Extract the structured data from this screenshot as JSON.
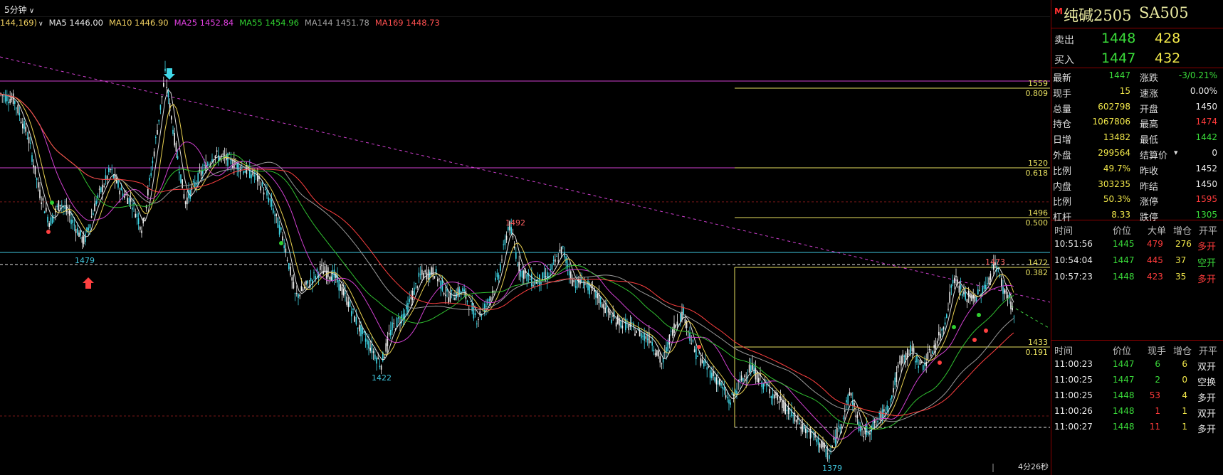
{
  "toolbar": {
    "period": "5分钟"
  },
  "ma_legend": [
    {
      "label": "144,169)",
      "color": "#f0d060"
    },
    {
      "label": "MA5 1446.00",
      "color": "#e8e8e8"
    },
    {
      "label": "MA10 1446.90",
      "color": "#f0d060"
    },
    {
      "label": "MA25 1452.84",
      "color": "#e040e0"
    },
    {
      "label": "MA55 1454.96",
      "color": "#30d030"
    },
    {
      "label": "MA144 1451.78",
      "color": "#a0a0a0"
    },
    {
      "label": "MA169 1448.73",
      "color": "#ff5050"
    }
  ],
  "levels": [
    {
      "price": "1559",
      "ratio": "0.809"
    },
    {
      "price": "1520",
      "ratio": "0.618"
    },
    {
      "price": "1496",
      "ratio": "0.500"
    },
    {
      "price": "1472",
      "ratio": "0.382"
    },
    {
      "price": "1433",
      "ratio": "0.191"
    }
  ],
  "annotations": {
    "low_1479": "1479",
    "high_1492": "1492",
    "low_1422": "1422",
    "high_1473": "1473",
    "low_1379": "1379",
    "countdown": "4分26秒"
  },
  "panel": {
    "indicator": "M",
    "name": "纯碱2505",
    "code": "SA505",
    "orderbook": [
      {
        "label": "卖出",
        "price": "1448",
        "volume": "428"
      },
      {
        "label": "买入",
        "price": "1447",
        "volume": "432"
      }
    ],
    "quote": [
      {
        "l1": "最新",
        "v1": "1447",
        "c1": "green",
        "l2": "涨跌",
        "v2": "-3/0.21%",
        "c2": "green"
      },
      {
        "l1": "现手",
        "v1": "15",
        "c1": "yellow",
        "l2": "速涨",
        "v2": "0.00%",
        "c2": "white"
      },
      {
        "l1": "总量",
        "v1": "602798",
        "c1": "yellow",
        "l2": "开盘",
        "v2": "1450",
        "c2": "white"
      },
      {
        "l1": "持仓",
        "v1": "1067806",
        "c1": "yellow",
        "l2": "最高",
        "v2": "1474",
        "c2": "red"
      },
      {
        "l1": "日增",
        "v1": "13482",
        "c1": "yellow",
        "l2": "最低",
        "v2": "1442",
        "c2": "green"
      },
      {
        "l1": "外盘",
        "v1": "299564",
        "c1": "yellow",
        "l2": "结算价",
        "v2": "0",
        "c2": "white"
      },
      {
        "l1": "比例",
        "v1": "49.7%",
        "c1": "yellow",
        "l2": "昨收",
        "v2": "1452",
        "c2": "white"
      },
      {
        "l1": "内盘",
        "v1": "303235",
        "c1": "yellow",
        "l2": "昨结",
        "v2": "1450",
        "c2": "white"
      },
      {
        "l1": "比例",
        "v1": "50.3%",
        "c1": "yellow",
        "l2": "涨停",
        "v2": "1595",
        "c2": "red"
      },
      {
        "l1": "杠杆",
        "v1": "8.33",
        "c1": "yellow",
        "l2": "跌停",
        "v2": "1305",
        "c2": "green"
      }
    ],
    "big_trades_header": {
      "time": "时间",
      "price": "价位",
      "big": "大单",
      "inc": "增仓",
      "type": "开平"
    },
    "big_trades": [
      {
        "time": "10:51:56",
        "price": "1445",
        "big": "479",
        "inc": "276",
        "type": "多开",
        "tc": "red"
      },
      {
        "time": "10:54:04",
        "price": "1447",
        "big": "445",
        "inc": "37",
        "type": "空开",
        "tc": "green"
      },
      {
        "time": "10:57:23",
        "price": "1448",
        "big": "423",
        "inc": "35",
        "type": "多开",
        "tc": "red"
      }
    ],
    "ticks_header": {
      "time": "时间",
      "price": "价位",
      "hand": "现手",
      "inc": "增仓",
      "type": "开平"
    },
    "ticks": [
      {
        "time": "11:00:23",
        "price": "1447",
        "hand": "6",
        "inc": "6",
        "type": "双开",
        "hc": "green"
      },
      {
        "time": "11:00:25",
        "price": "1447",
        "hand": "2",
        "inc": "0",
        "type": "空换",
        "hc": "green"
      },
      {
        "time": "11:00:25",
        "price": "1448",
        "hand": "53",
        "inc": "4",
        "type": "多开",
        "hc": "red"
      },
      {
        "time": "11:00:26",
        "price": "1448",
        "hand": "1",
        "inc": "1",
        "type": "双开",
        "hc": "red"
      },
      {
        "time": "11:00:27",
        "price": "1448",
        "hand": "11",
        "inc": "1",
        "type": "多开",
        "hc": "red"
      }
    ]
  }
}
